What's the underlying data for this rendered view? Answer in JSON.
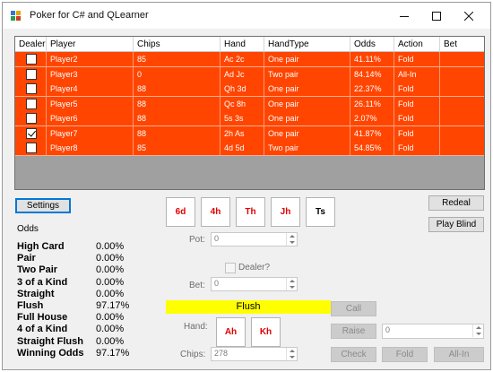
{
  "window": {
    "title": "Poker for C# and QLearner",
    "controls": [
      "minimize-icon",
      "maximize-icon",
      "close-icon"
    ]
  },
  "grid": {
    "columns": [
      "Dealer",
      "Player",
      "Chips",
      "Hand",
      "HandType",
      "Odds",
      "Action",
      "Bet"
    ],
    "rows": [
      {
        "dealer": false,
        "player": "Player2",
        "chips": "85",
        "hand": "Ac 2c",
        "handtype": "One pair",
        "odds": "41.11%",
        "action": "Fold",
        "bet": ""
      },
      {
        "dealer": false,
        "player": "Player3",
        "chips": "0",
        "hand": "Ad Jc",
        "handtype": "Two pair",
        "odds": "84.14%",
        "action": "All-In",
        "bet": ""
      },
      {
        "dealer": false,
        "player": "Player4",
        "chips": "88",
        "hand": "Qh 3d",
        "handtype": "One pair",
        "odds": "22.37%",
        "action": "Fold",
        "bet": ""
      },
      {
        "dealer": false,
        "player": "Player5",
        "chips": "88",
        "hand": "Qc 8h",
        "handtype": "One pair",
        "odds": "26.11%",
        "action": "Fold",
        "bet": ""
      },
      {
        "dealer": false,
        "player": "Player6",
        "chips": "88",
        "hand": "5s 3s",
        "handtype": "One pair",
        "odds": "2.07%",
        "action": "Fold",
        "bet": ""
      },
      {
        "dealer": true,
        "player": "Player7",
        "chips": "88",
        "hand": "2h As",
        "handtype": "One pair",
        "odds": "41.87%",
        "action": "Fold",
        "bet": ""
      },
      {
        "dealer": false,
        "player": "Player8",
        "chips": "85",
        "hand": "4d 5d",
        "handtype": "Two pair",
        "odds": "54.85%",
        "action": "Fold",
        "bet": ""
      }
    ],
    "row_color": "#ff4500"
  },
  "buttons": {
    "settings": "Settings",
    "redeal": "Redeal",
    "play_blind": "Play Blind",
    "call": "Call",
    "raise": "Raise",
    "check": "Check",
    "fold": "Fold",
    "all_in": "All-In"
  },
  "board": {
    "cards": [
      {
        "label": "6d",
        "color": "#e00000"
      },
      {
        "label": "4h",
        "color": "#e00000"
      },
      {
        "label": "Th",
        "color": "#e00000"
      },
      {
        "label": "Jh",
        "color": "#e00000"
      },
      {
        "label": "Ts",
        "color": "#000000"
      }
    ]
  },
  "odds": {
    "title": "Odds",
    "items": [
      {
        "name": "High Card",
        "value": "0.00%"
      },
      {
        "name": "Pair",
        "value": "0.00%"
      },
      {
        "name": "Two Pair",
        "value": "0.00%"
      },
      {
        "name": "3 of a Kind",
        "value": "0.00%"
      },
      {
        "name": "Straight",
        "value": "0.00%"
      },
      {
        "name": "Flush",
        "value": "97.17%"
      },
      {
        "name": "Full House",
        "value": "0.00%"
      },
      {
        "name": "4 of a Kind",
        "value": "0.00%"
      },
      {
        "name": "Straight Flush",
        "value": "0.00%"
      },
      {
        "name": "Winning Odds",
        "value": "97.17%"
      }
    ]
  },
  "controls": {
    "pot_label": "Pot:",
    "pot_value": "0",
    "dealer_label": "Dealer?",
    "bet_label": "Bet:",
    "bet_value": "0",
    "hand_type": "Flush",
    "hand_type_color": "#ffff00",
    "hand_label": "Hand:",
    "hand_cards": [
      {
        "label": "Ah",
        "color": "#e00000"
      },
      {
        "label": "Kh",
        "color": "#e00000"
      }
    ],
    "chips_label": "Chips:",
    "chips_value": "278",
    "raise_value": "0"
  }
}
